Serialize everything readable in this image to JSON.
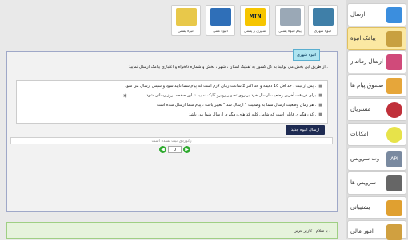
{
  "sidebar": {
    "items": [
      {
        "label": "ارسال",
        "icon": "sms-envelope-icon",
        "color": "#3b8ede",
        "active": false
      },
      {
        "label": "پیامک انبوه",
        "icon": "antenna-icon",
        "color": "#c8a040",
        "active": true
      },
      {
        "label": "ارسال زماندار",
        "icon": "calendar-icon",
        "color": "#d04a7a",
        "active": false
      },
      {
        "label": "صندوق پیام ها",
        "icon": "inbox-icon",
        "color": "#e6a63a",
        "active": false
      },
      {
        "label": "مشتریان",
        "icon": "customers-icon",
        "color": "#c0303a",
        "active": false
      },
      {
        "label": "امکانات",
        "icon": "features-icon",
        "color": "#e7e34a",
        "active": false
      },
      {
        "label": "وب سرویس",
        "icon": "api-icon",
        "color": "#7a8aa0",
        "active": false
      },
      {
        "label": "سرویس ها",
        "icon": "services-icon",
        "color": "#666666",
        "active": false
      },
      {
        "label": "پشتیبانی",
        "icon": "support-cap-icon",
        "color": "#e0a030",
        "active": false
      },
      {
        "label": "امور مالی",
        "icon": "finance-icon",
        "color": "#d0a040",
        "active": false
      }
    ]
  },
  "services": [
    {
      "label": "انبوه شهری",
      "logo_color": "#3f7fa8"
    },
    {
      "label": "پیام انبوه پستی",
      "logo_color": "#9aa8b6"
    },
    {
      "label": "شهری و پستی",
      "logo_color": "#f6c500"
    },
    {
      "label": "انبوه منتی",
      "logo_color": "#2f6fb8"
    },
    {
      "label": "انبوه پستی",
      "logo_color": "#e8c84a"
    }
  ],
  "panel": {
    "tab": "انبوه شهری",
    "info": "از طریق این بخش می توانید به کل کشور به تفکیک استان ، شهر ، بخش و شماره دلخواه و اعتباری پیامک ارسال نمایید .",
    "notes": [
      "پس از ثبت ، حد اقل 10 دقیقه و حد اکثر 2 ساعت زمان لازم است که پیام شما تایید شود و سپس ارسال می شود .",
      "برای دریافت آخرین وضعیت ارسال خود بر روی تصویر روبرو کلیک نمایید تا این صفحه بروز رسانی شود",
      "هر زمان وضعیت ارسال شما به وضعیت \" ارسال شد \" تغییر یافت ، پیام شما ارسال شده است .",
      "کد رهگیری قابلی است که شامل کلیه کد های رهگیری ارسال شما می باشد ."
    ],
    "send_button": "ارسال انبوه جدید",
    "empty_message": "رکوردی ثبت نشده است",
    "page_number": "0"
  },
  "welcome": {
    "text": "با سلام ، کاربر عزیز :"
  }
}
